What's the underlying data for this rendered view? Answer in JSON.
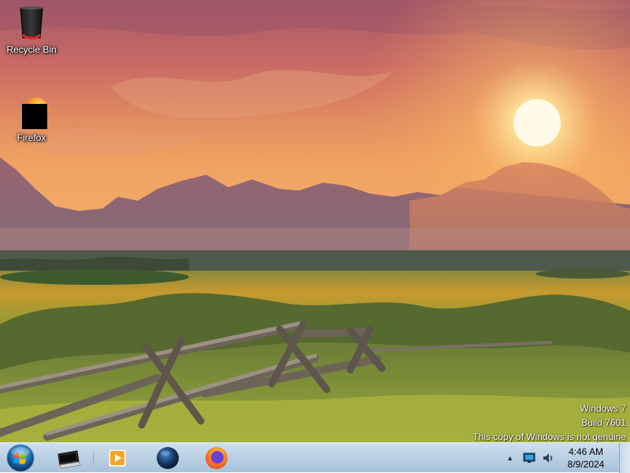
{
  "desktop": {
    "icons": [
      {
        "label": "Recycle Bin",
        "icon": "recycle-bin-icon"
      },
      {
        "label": "Firefox",
        "icon": "firefox-icon"
      }
    ],
    "watermark": {
      "line1": "Windows 7",
      "line2": "Build 7601",
      "line3": "This copy of Windows is not genuine"
    }
  },
  "taskbar": {
    "start_button": "start-orb-icon",
    "pinned": [
      {
        "icon": "show-desktop-window-icon"
      },
      {
        "icon": "media-player-icon"
      },
      {
        "icon": "globe-icon"
      },
      {
        "icon": "firefox-icon"
      }
    ],
    "tray": {
      "icons": [
        "show-hidden-icons-arrow",
        "network-icon",
        "volume-icon"
      ],
      "time": "4:46 AM",
      "date": "8/9/2024"
    }
  },
  "colors": {
    "taskbar_top": "#cfe0ee",
    "taskbar_bottom": "#a9c2da",
    "sky_glow": "#f3a35c",
    "sun": "#fff7d6"
  }
}
